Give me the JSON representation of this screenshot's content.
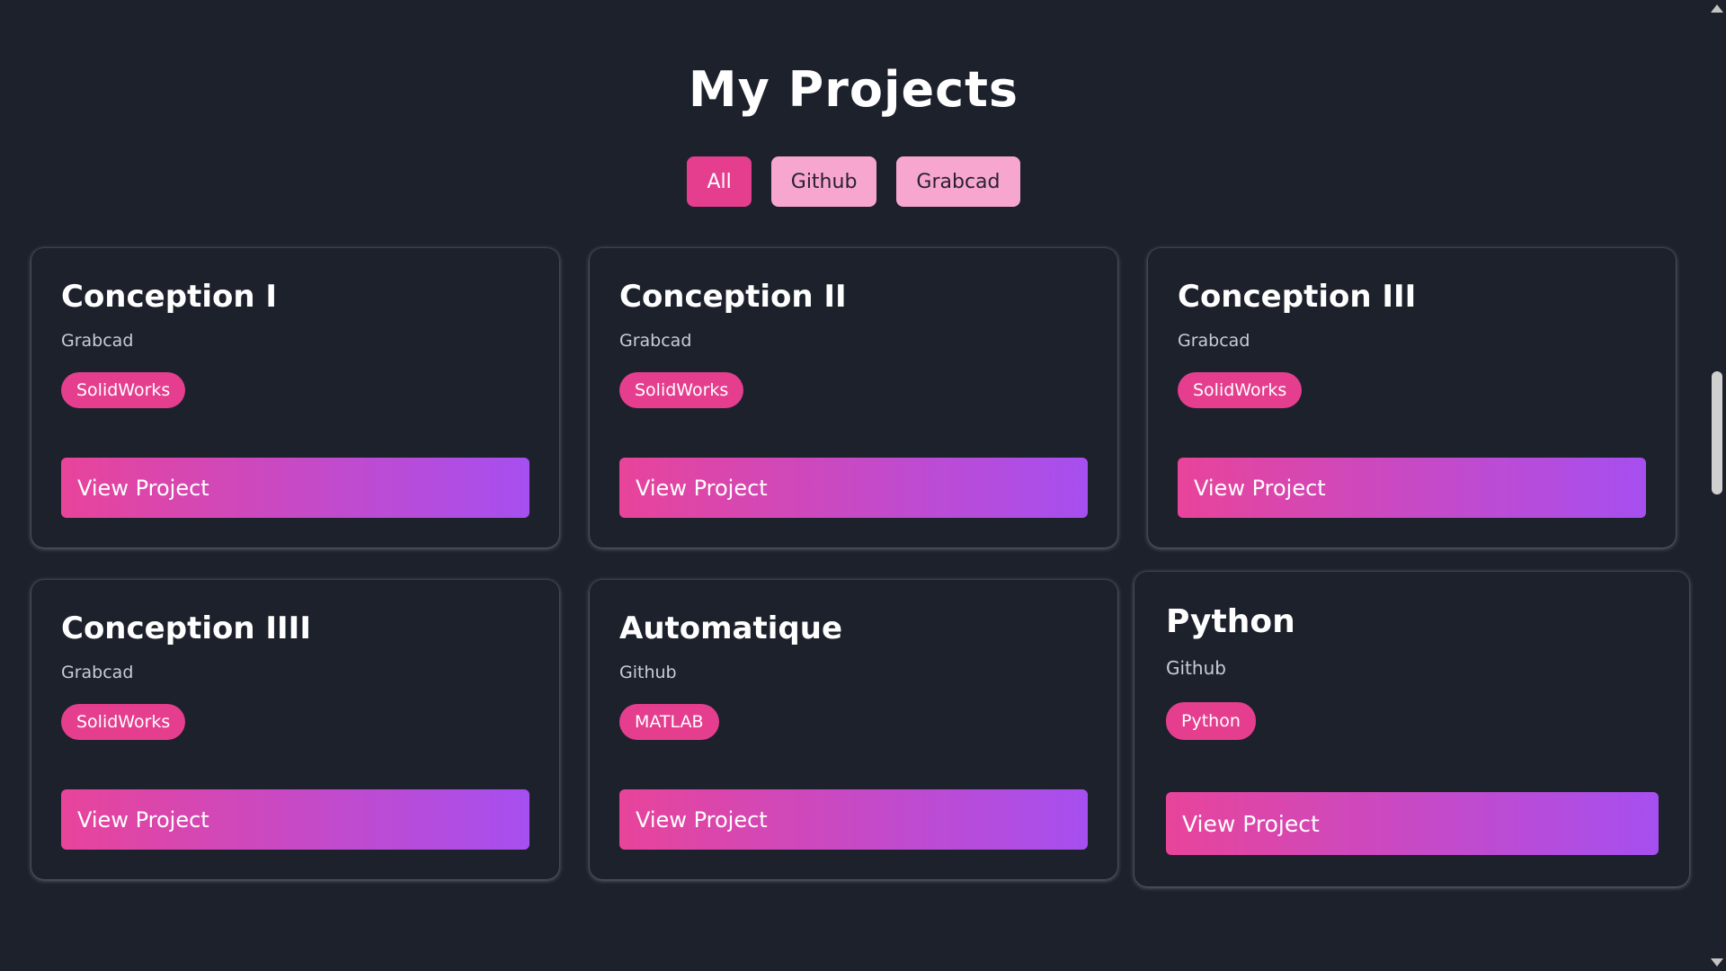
{
  "header": {
    "title": "My Projects"
  },
  "filters": [
    {
      "label": "All",
      "active": true
    },
    {
      "label": "Github",
      "active": false
    },
    {
      "label": "Grabcad",
      "active": false
    }
  ],
  "projects": [
    {
      "title": "Conception I",
      "source": "Grabcad",
      "tag": "SolidWorks",
      "button": "View Project"
    },
    {
      "title": "Conception II",
      "source": "Grabcad",
      "tag": "SolidWorks",
      "button": "View Project"
    },
    {
      "title": "Conception III",
      "source": "Grabcad",
      "tag": "SolidWorks",
      "button": "View Project"
    },
    {
      "title": "Conception IIII",
      "source": "Grabcad",
      "tag": "SolidWorks",
      "button": "View Project"
    },
    {
      "title": "Automatique",
      "source": "Github",
      "tag": "MATLAB",
      "button": "View Project"
    },
    {
      "title": "Python",
      "source": "Github",
      "tag": "Python",
      "button": "View Project"
    }
  ],
  "colors": {
    "background": "#1c212c",
    "accent": "#e53e8f",
    "accent_light": "#f7a7cf",
    "gradient_end": "#a64ff0"
  }
}
